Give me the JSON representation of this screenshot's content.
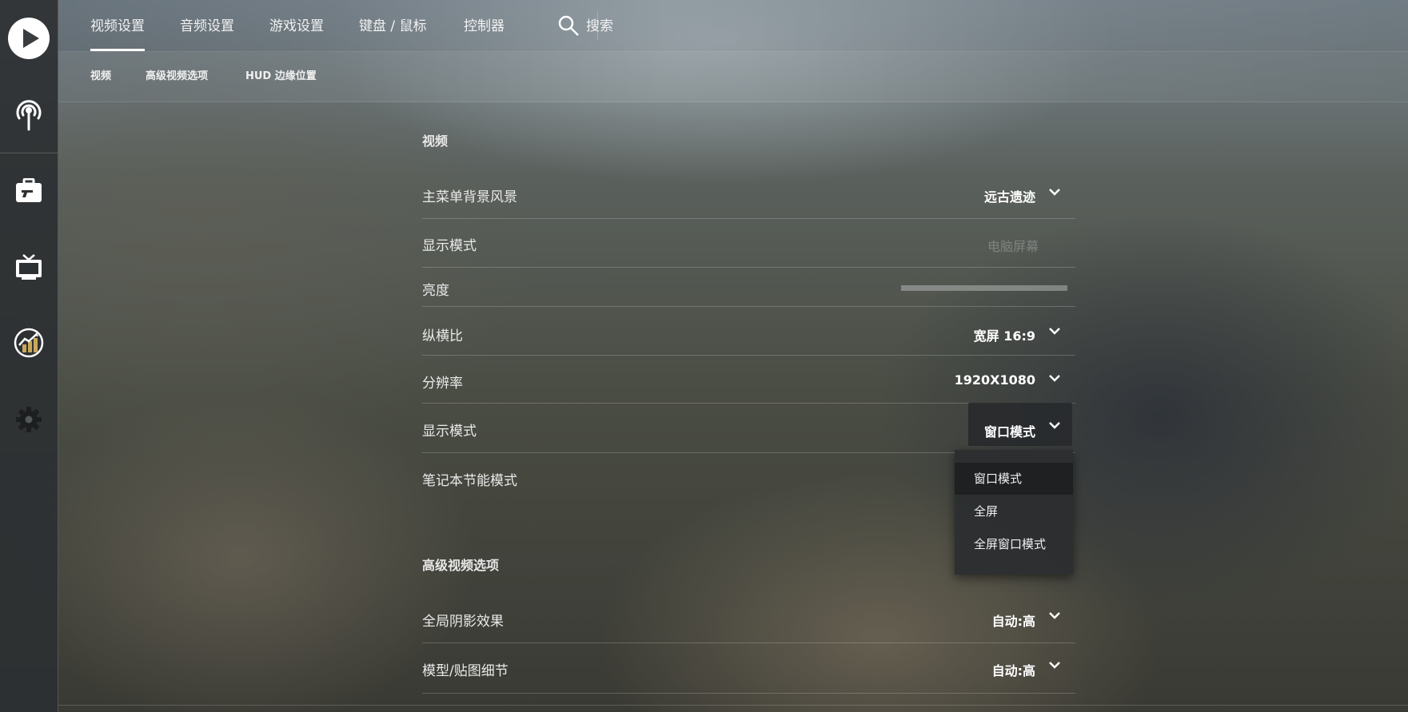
{
  "sidebar": {
    "items": [
      {
        "icon": "play-icon"
      },
      {
        "icon": "broadcast-icon"
      },
      {
        "icon": "inventory-icon"
      },
      {
        "icon": "tv-icon"
      },
      {
        "icon": "stats-icon"
      },
      {
        "icon": "gear-icon"
      }
    ]
  },
  "topnav": {
    "tabs": [
      {
        "label": "视频设置",
        "active": true
      },
      {
        "label": "音频设置"
      },
      {
        "label": "游戏设置"
      },
      {
        "label": "键盘 / 鼠标"
      },
      {
        "label": "控制器"
      }
    ],
    "search_label": "搜索"
  },
  "subnav": {
    "tabs": [
      {
        "label": "视频"
      },
      {
        "label": "高级视频选项"
      },
      {
        "label": "HUD 边缘位置"
      }
    ]
  },
  "video": {
    "title": "视频",
    "rows": [
      {
        "label": "主菜单背景风景",
        "value": "远古遗迹"
      },
      {
        "label": "显示模式",
        "value": "电脑屏幕"
      },
      {
        "label": "亮度"
      },
      {
        "label": "纵横比",
        "value": "宽屏 16:9"
      },
      {
        "label": "分辨率",
        "value": "1920X1080"
      },
      {
        "label": "显示模式",
        "value": "窗口模式"
      },
      {
        "label": "笔记本节能模式"
      }
    ]
  },
  "dropdown": {
    "options": [
      "窗口模式",
      "全屏",
      "全屏窗口模式"
    ],
    "selected": "窗口模式"
  },
  "advanced": {
    "title": "高级视频选项",
    "rows": [
      {
        "label": "全局阴影效果",
        "value": "自动:高"
      },
      {
        "label": "模型/贴图细节",
        "value": "自动:高"
      }
    ]
  }
}
